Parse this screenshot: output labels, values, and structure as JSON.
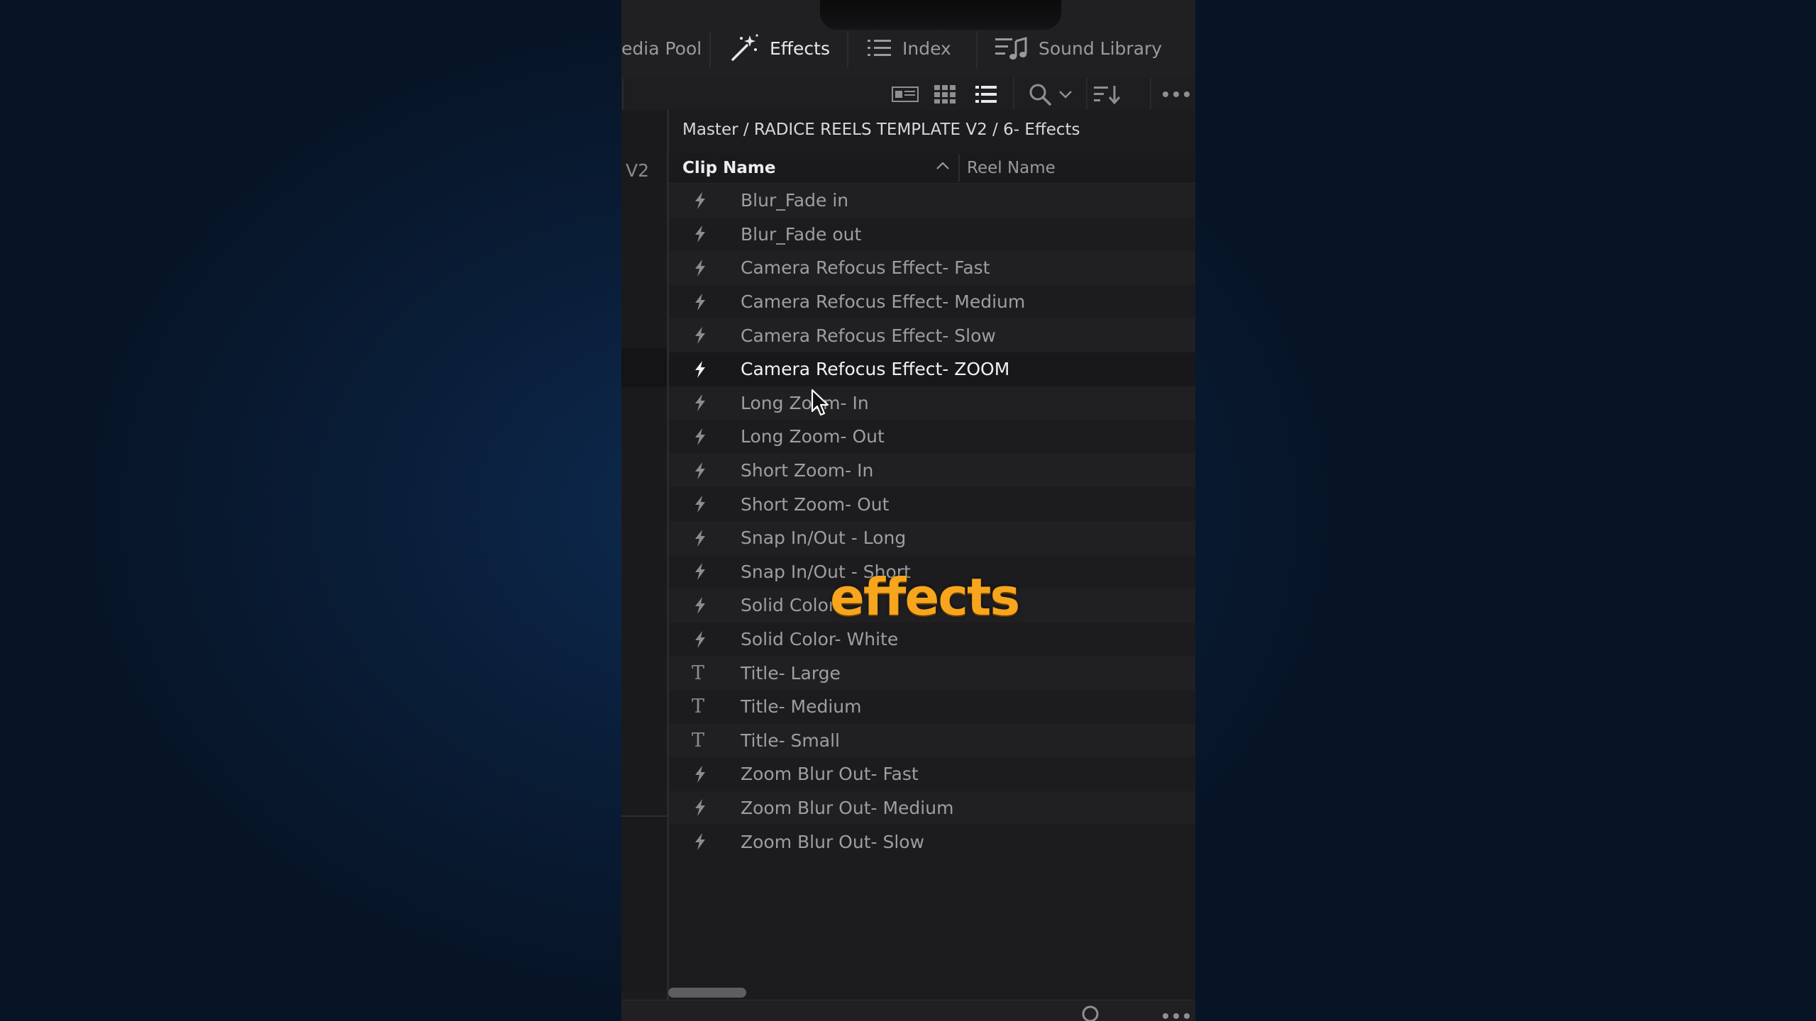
{
  "tabs": [
    {
      "label": "edia Pool",
      "icon": "media-pool-icon",
      "active": false
    },
    {
      "label": "Effects",
      "icon": "magic-wand-icon",
      "active": true
    },
    {
      "label": "Index",
      "icon": "list-icon",
      "active": false
    },
    {
      "label": "Sound Library",
      "icon": "music-note-icon",
      "active": false
    }
  ],
  "toolbar": {
    "icons": [
      "filmstrip-view-icon",
      "grid-view-icon",
      "list-view-icon",
      "search-icon",
      "chevron-down-icon",
      "sort-icon",
      "more-options-icon"
    ]
  },
  "left_panel": {
    "track_label": "V2"
  },
  "breadcrumb": "Master / RADICE REELS TEMPLATE V2 / 6- Effects",
  "table": {
    "columns": [
      "Clip Name",
      "Reel Name"
    ],
    "rows": [
      {
        "name": "Blur_Fade in",
        "icon": "effect-icon"
      },
      {
        "name": "Blur_Fade out",
        "icon": "effect-icon"
      },
      {
        "name": "Camera Refocus Effect- Fast",
        "icon": "effect-icon"
      },
      {
        "name": "Camera Refocus Effect- Medium",
        "icon": "effect-icon"
      },
      {
        "name": "Camera Refocus Effect- Slow",
        "icon": "effect-icon"
      },
      {
        "name": "Camera Refocus Effect- ZOOM",
        "icon": "effect-icon",
        "selected": true
      },
      {
        "name": "Long Zoom- In",
        "icon": "effect-icon"
      },
      {
        "name": "Long Zoom- Out",
        "icon": "effect-icon"
      },
      {
        "name": "Short Zoom- In",
        "icon": "effect-icon"
      },
      {
        "name": "Short Zoom- Out",
        "icon": "effect-icon"
      },
      {
        "name": "Snap In/Out - Long",
        "icon": "effect-icon"
      },
      {
        "name": "Snap In/Out - Short",
        "icon": "effect-icon"
      },
      {
        "name": "Solid Color-",
        "icon": "effect-icon"
      },
      {
        "name": "Solid Color- White",
        "icon": "effect-icon"
      },
      {
        "name": "Title- Large",
        "icon": "title-icon"
      },
      {
        "name": "Title- Medium",
        "icon": "title-icon"
      },
      {
        "name": "Title- Small",
        "icon": "title-icon"
      },
      {
        "name": "Zoom Blur Out- Fast",
        "icon": "effect-icon"
      },
      {
        "name": "Zoom Blur Out- Medium",
        "icon": "effect-icon"
      },
      {
        "name": "Zoom Blur Out- Slow",
        "icon": "effect-icon"
      }
    ]
  },
  "caption": "effects",
  "colors": {
    "caption": "#f7a51c",
    "panel_bg": "#1c1c1e",
    "text_dim": "#9e9ea1",
    "text_bright": "#f2f2f4"
  }
}
